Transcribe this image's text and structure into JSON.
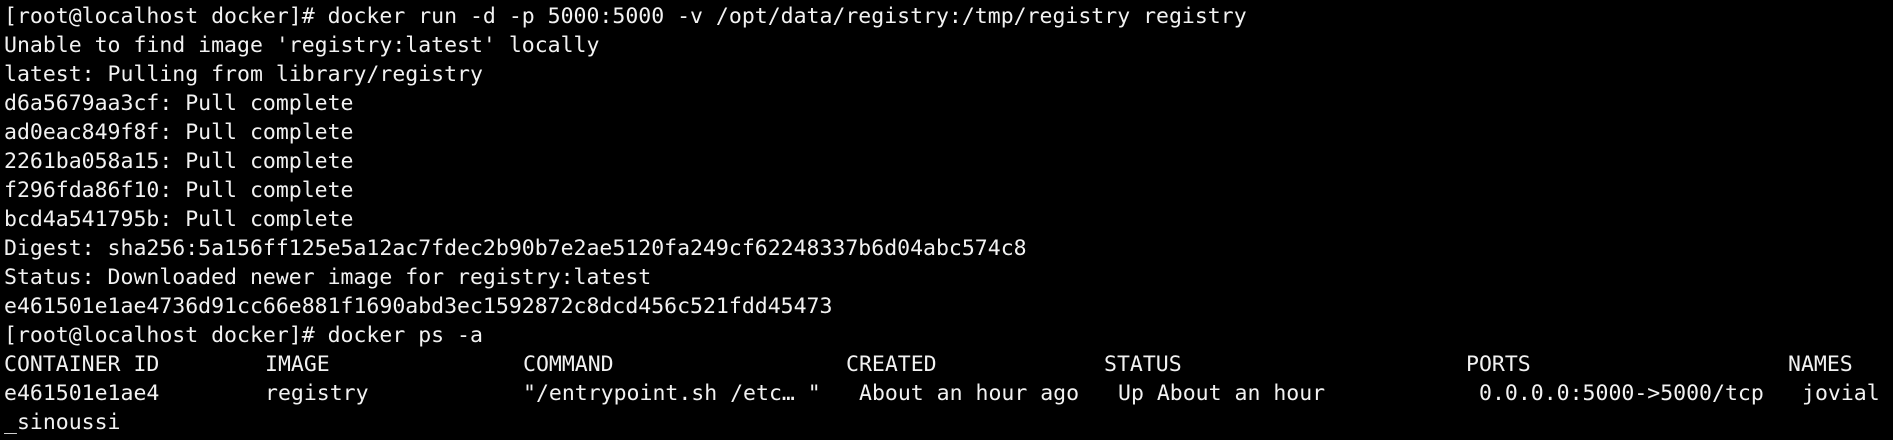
{
  "terminal": {
    "lines_before": [
      "[root@localhost docker]# docker run -d -p 5000:5000 -v /opt/data/registry:/tmp/registry registry",
      "Unable to find image 'registry:latest' locally",
      "latest: Pulling from library/registry",
      "d6a5679aa3cf: Pull complete",
      "ad0eac849f8f: Pull complete",
      "2261ba058a15: Pull complete",
      "f296fda86f10: Pull complete",
      "bcd4a541795b: Pull complete",
      "Digest: sha256:5a156ff125e5a12ac7fdec2b90b7e2ae5120fa249cf62248337b6d04abc574c8",
      "Status: Downloaded newer image for registry:latest",
      "e461501e1ae4736d91cc66e881f1690abd3ec1592872c8dcd456c521fdd45473",
      "[root@localhost docker]# docker ps -a"
    ],
    "ps_table": {
      "headers": {
        "container_id": "CONTAINER ID",
        "image": "IMAGE",
        "command": "COMMAND",
        "created": "CREATED",
        "status": "STATUS",
        "ports": "PORTS",
        "names": "NAMES"
      },
      "rows": [
        {
          "container_id": "e461501e1ae4",
          "image": "registry",
          "command": "\"/entrypoint.sh /etc… \"",
          "created": "About an hour ago",
          "status": "Up About an hour",
          "ports": "0.0.0.0:5000->5000/tcp",
          "names": "jovial",
          "names_wrap": "_sinoussi"
        }
      ]
    }
  }
}
